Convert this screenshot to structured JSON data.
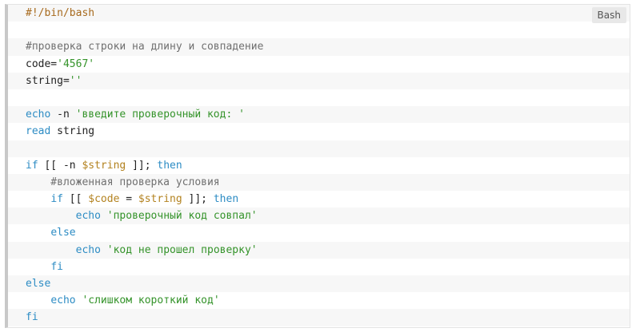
{
  "code_block": {
    "language_label": "Bash",
    "lines": [
      [
        {
          "t": "#!/bin/bash",
          "c": "shebang"
        }
      ],
      [],
      [
        {
          "t": "#проверка строки на длину и совпадение",
          "c": "comment"
        }
      ],
      [
        {
          "t": "code=",
          "c": "plain"
        },
        {
          "t": "'4567'",
          "c": "string"
        }
      ],
      [
        {
          "t": "string=",
          "c": "plain"
        },
        {
          "t": "''",
          "c": "string"
        }
      ],
      [],
      [
        {
          "t": "echo",
          "c": "keyword"
        },
        {
          "t": " -n ",
          "c": "plain"
        },
        {
          "t": "'введите проверочный код: '",
          "c": "string"
        }
      ],
      [
        {
          "t": "read",
          "c": "keyword"
        },
        {
          "t": " string",
          "c": "plain"
        }
      ],
      [],
      [
        {
          "t": "if",
          "c": "keyword"
        },
        {
          "t": " [[ -n ",
          "c": "plain"
        },
        {
          "t": "$string",
          "c": "var"
        },
        {
          "t": " ]]; ",
          "c": "plain"
        },
        {
          "t": "then",
          "c": "keyword"
        }
      ],
      [
        {
          "t": "    #вложенная проверка условия",
          "c": "comment"
        }
      ],
      [
        {
          "t": "    ",
          "c": "plain"
        },
        {
          "t": "if",
          "c": "keyword"
        },
        {
          "t": " [[ ",
          "c": "plain"
        },
        {
          "t": "$code",
          "c": "var"
        },
        {
          "t": " = ",
          "c": "plain"
        },
        {
          "t": "$string",
          "c": "var"
        },
        {
          "t": " ]]; ",
          "c": "plain"
        },
        {
          "t": "then",
          "c": "keyword"
        }
      ],
      [
        {
          "t": "        ",
          "c": "plain"
        },
        {
          "t": "echo",
          "c": "keyword"
        },
        {
          "t": " ",
          "c": "plain"
        },
        {
          "t": "'проверочный код совпал'",
          "c": "string"
        }
      ],
      [
        {
          "t": "    ",
          "c": "plain"
        },
        {
          "t": "else",
          "c": "keyword"
        }
      ],
      [
        {
          "t": "        ",
          "c": "plain"
        },
        {
          "t": "echo",
          "c": "keyword"
        },
        {
          "t": " ",
          "c": "plain"
        },
        {
          "t": "'код не прошел проверку'",
          "c": "string"
        }
      ],
      [
        {
          "t": "    ",
          "c": "plain"
        },
        {
          "t": "fi",
          "c": "keyword"
        }
      ],
      [
        {
          "t": "else",
          "c": "keyword"
        }
      ],
      [
        {
          "t": "    ",
          "c": "plain"
        },
        {
          "t": "echo",
          "c": "keyword"
        },
        {
          "t": " ",
          "c": "plain"
        },
        {
          "t": "'слишком короткий код'",
          "c": "string"
        }
      ],
      [
        {
          "t": "fi",
          "c": "keyword"
        }
      ]
    ]
  },
  "colors": {
    "keyword": "#2d8cc4",
    "string": "#34932a",
    "comment": "#707070",
    "variable": "#b3821f",
    "shebang": "#a76a1e",
    "stripe": "#f7f7f7"
  }
}
